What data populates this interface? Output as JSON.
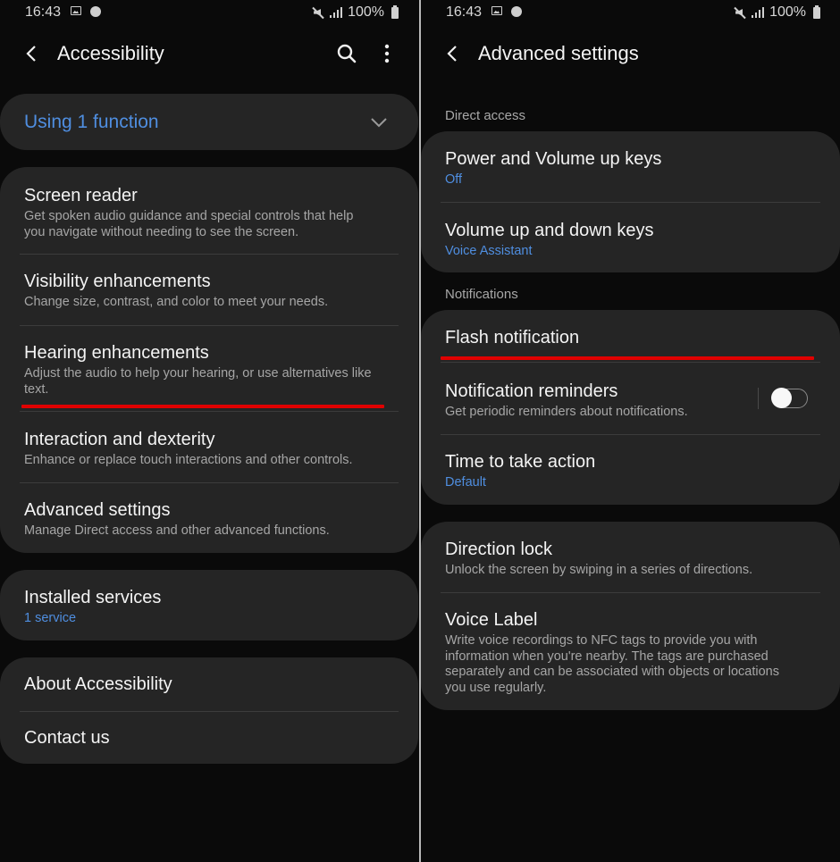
{
  "status_bar": {
    "time": "16:43",
    "left_icons": [
      "gallery-icon",
      "dex-icon"
    ],
    "right_icons": [
      "mute-icon",
      "signal-icon"
    ],
    "battery": "100%"
  },
  "left_screen": {
    "title": "Accessibility",
    "actions": [
      "search-icon",
      "more-options-icon"
    ],
    "summary": {
      "label": "Using 1 function",
      "icon": "chevron-down-icon"
    },
    "main_items": [
      {
        "title": "Screen reader",
        "subtitle": "Get spoken audio guidance and special controls that help you navigate without needing to see the screen."
      },
      {
        "title": "Visibility enhancements",
        "subtitle": "Change size, contrast, and color to meet your needs."
      },
      {
        "title": "Hearing enhancements",
        "subtitle": "Adjust the audio to help your hearing, or use alternatives like text."
      },
      {
        "title": "Interaction and dexterity",
        "subtitle": "Enhance or replace touch interactions and other controls."
      },
      {
        "title": "Advanced settings",
        "subtitle": "Manage Direct access and other advanced functions."
      }
    ],
    "installed_services": {
      "title": "Installed services",
      "value": "1 service"
    },
    "footer_items": [
      {
        "title": "About Accessibility"
      },
      {
        "title": "Contact us"
      }
    ]
  },
  "right_screen": {
    "title": "Advanced settings",
    "direct_access": {
      "header": "Direct access",
      "items": [
        {
          "title": "Power and Volume up keys",
          "value": "Off"
        },
        {
          "title": "Volume up and down keys",
          "value": "Voice Assistant"
        }
      ]
    },
    "notifications": {
      "header": "Notifications",
      "items": [
        {
          "title": "Flash notification"
        },
        {
          "title": "Notification reminders",
          "subtitle": "Get periodic reminders about notifications.",
          "toggle_on": false
        },
        {
          "title": "Time to take action",
          "value": "Default"
        }
      ]
    },
    "other_items": [
      {
        "title": "Direction lock",
        "subtitle": "Unlock the screen by swiping in a series of directions."
      },
      {
        "title": "Voice Label",
        "subtitle": "Write voice recordings to NFC tags to provide you with information when you're nearby. The tags are purchased separately and can be associated with objects or locations you use regularly."
      }
    ]
  },
  "colors": {
    "background": "#0a0a0a",
    "card": "#252525",
    "accent_blue": "#4f8ee0",
    "highlight_red": "#e00000"
  }
}
